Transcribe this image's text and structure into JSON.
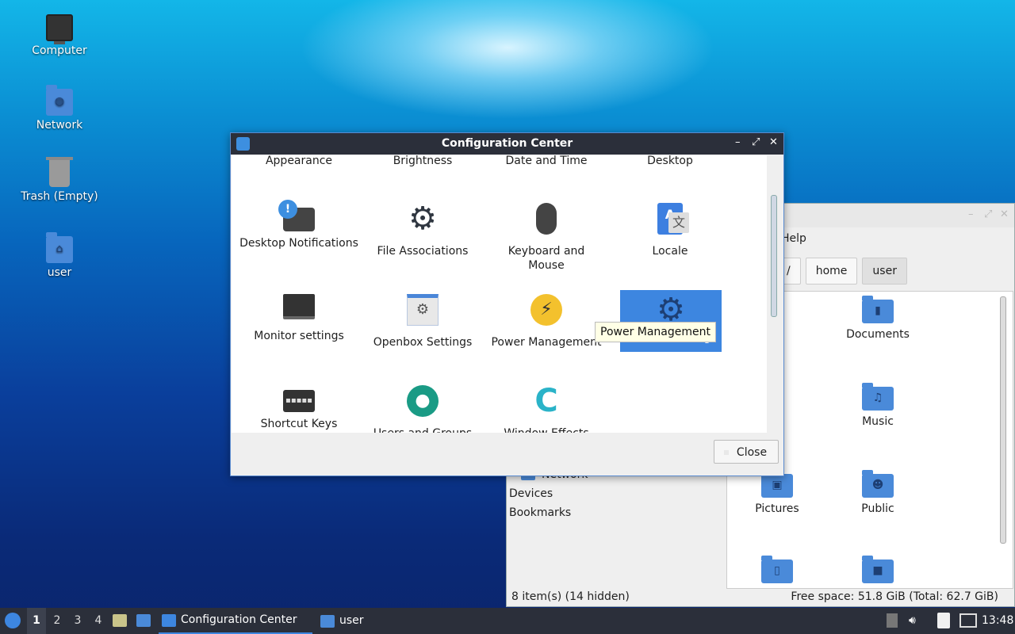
{
  "desktop": {
    "icons": [
      {
        "label": "Computer",
        "icon": "computer-icon"
      },
      {
        "label": "Network",
        "icon": "network-folder-icon"
      },
      {
        "label": "Trash (Empty)",
        "icon": "trash-icon"
      },
      {
        "label": "user",
        "icon": "home-folder-icon"
      }
    ]
  },
  "config_center": {
    "title": "Configuration Center",
    "top_row": [
      "Appearance",
      "Brightness",
      "Date and Time",
      "Desktop"
    ],
    "items": [
      {
        "label": "Desktop Notifications",
        "icon": "notification-icon"
      },
      {
        "label": "File Associations",
        "icon": "gear-icon"
      },
      {
        "label": "Keyboard and Mouse",
        "icon": "mouse-icon"
      },
      {
        "label": "Locale",
        "icon": "translate-icon"
      },
      {
        "label": "Monitor settings",
        "icon": "monitor-icon"
      },
      {
        "label": "Openbox Settings",
        "icon": "window-settings-icon"
      },
      {
        "label": "Power Management",
        "icon": "power-icon"
      },
      {
        "label": "Session Settings",
        "icon": "session-gear-icon"
      },
      {
        "label": "Shortcut Keys",
        "icon": "keyboard-icon"
      },
      {
        "label": "Users and Groups",
        "icon": "user-icon"
      },
      {
        "label": "Window Effects",
        "icon": "window-effects-icon"
      }
    ],
    "tooltip": "Power Management",
    "close_label": "Close",
    "accent": "#3d86e0"
  },
  "file_manager": {
    "menu_help": "Help",
    "crumbs": [
      "/",
      "home",
      "user"
    ],
    "sidebar": [
      "Network",
      "Devices",
      "Bookmarks"
    ],
    "items": [
      {
        "label": "op",
        "icon": "desktop-folder-icon"
      },
      {
        "label": "Documents",
        "icon": "documents-folder-icon"
      },
      {
        "label": "oads",
        "icon": "downloads-folder-icon"
      },
      {
        "label": "Music",
        "icon": "music-folder-icon"
      },
      {
        "label": "Pictures",
        "icon": "pictures-folder-icon"
      },
      {
        "label": "Public",
        "icon": "public-folder-icon"
      },
      {
        "label": "",
        "icon": "templates-folder-icon"
      },
      {
        "label": "",
        "icon": "videos-folder-icon"
      }
    ],
    "status_left": "8 item(s) (14 hidden)",
    "status_right": "Free space: 51.8 GiB (Total: 62.7 GiB)"
  },
  "taskbar": {
    "workspaces": [
      "1",
      "2",
      "3",
      "4"
    ],
    "tasks": [
      {
        "label": "Configuration Center",
        "icon": "config-center-icon"
      },
      {
        "label": "user",
        "icon": "folder-icon"
      }
    ],
    "clock": "13:48"
  }
}
